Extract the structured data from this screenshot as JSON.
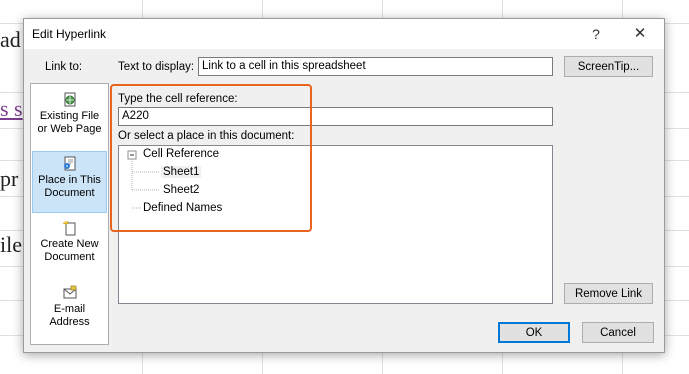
{
  "background": {
    "fragments": [
      "ad",
      "s s",
      "pr",
      "ile"
    ]
  },
  "dialog": {
    "title": "Edit Hyperlink",
    "help_glyph": "?",
    "close_glyph": "✕",
    "link_to_label": "Link to:",
    "text_to_display_label": "Text to display:",
    "text_to_display_value": "Link to a cell in this spreadsheet",
    "screentip_label": "ScreenTip...",
    "cell_ref_label": "Type the cell reference:",
    "cell_ref_value": "A220",
    "select_place_label": "Or select a place in this document:",
    "remove_link_label": "Remove Link",
    "ok_label": "OK",
    "cancel_label": "Cancel"
  },
  "link_to": [
    {
      "line1": "Existing File",
      "line2": "or Web Page",
      "icon": "globe-file-icon"
    },
    {
      "line1": "Place in This",
      "line2": "Document",
      "icon": "place-in-document-icon"
    },
    {
      "line1": "Create New",
      "line2": "Document",
      "icon": "new-document-icon"
    },
    {
      "line1": "E-mail",
      "line2": "Address",
      "icon": "email-icon"
    }
  ],
  "tree": {
    "root": "Cell Reference",
    "children": [
      "Sheet1",
      "Sheet2"
    ],
    "defined_names": "Defined Names",
    "expander": "−"
  },
  "colors": {
    "highlight": "#e8641e",
    "selected_bg": "#cce4f7",
    "default_button_border": "#0078d7"
  }
}
